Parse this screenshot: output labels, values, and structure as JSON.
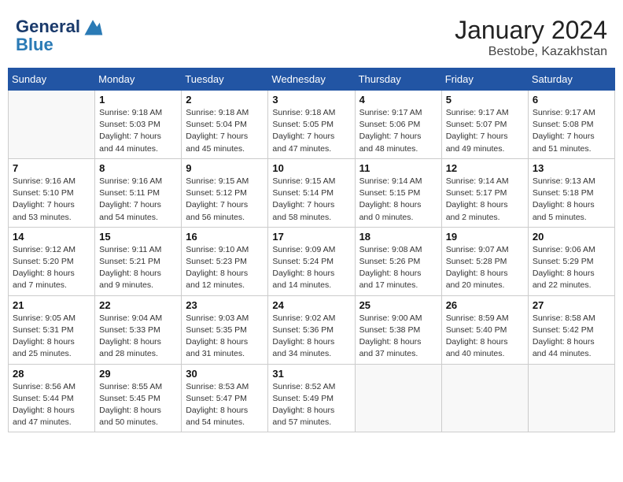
{
  "header": {
    "logo_line1": "General",
    "logo_line2": "Blue",
    "month": "January 2024",
    "location": "Bestobe, Kazakhstan"
  },
  "weekdays": [
    "Sunday",
    "Monday",
    "Tuesday",
    "Wednesday",
    "Thursday",
    "Friday",
    "Saturday"
  ],
  "weeks": [
    [
      {
        "day": "",
        "info": ""
      },
      {
        "day": "1",
        "info": "Sunrise: 9:18 AM\nSunset: 5:03 PM\nDaylight: 7 hours\nand 44 minutes."
      },
      {
        "day": "2",
        "info": "Sunrise: 9:18 AM\nSunset: 5:04 PM\nDaylight: 7 hours\nand 45 minutes."
      },
      {
        "day": "3",
        "info": "Sunrise: 9:18 AM\nSunset: 5:05 PM\nDaylight: 7 hours\nand 47 minutes."
      },
      {
        "day": "4",
        "info": "Sunrise: 9:17 AM\nSunset: 5:06 PM\nDaylight: 7 hours\nand 48 minutes."
      },
      {
        "day": "5",
        "info": "Sunrise: 9:17 AM\nSunset: 5:07 PM\nDaylight: 7 hours\nand 49 minutes."
      },
      {
        "day": "6",
        "info": "Sunrise: 9:17 AM\nSunset: 5:08 PM\nDaylight: 7 hours\nand 51 minutes."
      }
    ],
    [
      {
        "day": "7",
        "info": "Sunrise: 9:16 AM\nSunset: 5:10 PM\nDaylight: 7 hours\nand 53 minutes."
      },
      {
        "day": "8",
        "info": "Sunrise: 9:16 AM\nSunset: 5:11 PM\nDaylight: 7 hours\nand 54 minutes."
      },
      {
        "day": "9",
        "info": "Sunrise: 9:15 AM\nSunset: 5:12 PM\nDaylight: 7 hours\nand 56 minutes."
      },
      {
        "day": "10",
        "info": "Sunrise: 9:15 AM\nSunset: 5:14 PM\nDaylight: 7 hours\nand 58 minutes."
      },
      {
        "day": "11",
        "info": "Sunrise: 9:14 AM\nSunset: 5:15 PM\nDaylight: 8 hours\nand 0 minutes."
      },
      {
        "day": "12",
        "info": "Sunrise: 9:14 AM\nSunset: 5:17 PM\nDaylight: 8 hours\nand 2 minutes."
      },
      {
        "day": "13",
        "info": "Sunrise: 9:13 AM\nSunset: 5:18 PM\nDaylight: 8 hours\nand 5 minutes."
      }
    ],
    [
      {
        "day": "14",
        "info": "Sunrise: 9:12 AM\nSunset: 5:20 PM\nDaylight: 8 hours\nand 7 minutes."
      },
      {
        "day": "15",
        "info": "Sunrise: 9:11 AM\nSunset: 5:21 PM\nDaylight: 8 hours\nand 9 minutes."
      },
      {
        "day": "16",
        "info": "Sunrise: 9:10 AM\nSunset: 5:23 PM\nDaylight: 8 hours\nand 12 minutes."
      },
      {
        "day": "17",
        "info": "Sunrise: 9:09 AM\nSunset: 5:24 PM\nDaylight: 8 hours\nand 14 minutes."
      },
      {
        "day": "18",
        "info": "Sunrise: 9:08 AM\nSunset: 5:26 PM\nDaylight: 8 hours\nand 17 minutes."
      },
      {
        "day": "19",
        "info": "Sunrise: 9:07 AM\nSunset: 5:28 PM\nDaylight: 8 hours\nand 20 minutes."
      },
      {
        "day": "20",
        "info": "Sunrise: 9:06 AM\nSunset: 5:29 PM\nDaylight: 8 hours\nand 22 minutes."
      }
    ],
    [
      {
        "day": "21",
        "info": "Sunrise: 9:05 AM\nSunset: 5:31 PM\nDaylight: 8 hours\nand 25 minutes."
      },
      {
        "day": "22",
        "info": "Sunrise: 9:04 AM\nSunset: 5:33 PM\nDaylight: 8 hours\nand 28 minutes."
      },
      {
        "day": "23",
        "info": "Sunrise: 9:03 AM\nSunset: 5:35 PM\nDaylight: 8 hours\nand 31 minutes."
      },
      {
        "day": "24",
        "info": "Sunrise: 9:02 AM\nSunset: 5:36 PM\nDaylight: 8 hours\nand 34 minutes."
      },
      {
        "day": "25",
        "info": "Sunrise: 9:00 AM\nSunset: 5:38 PM\nDaylight: 8 hours\nand 37 minutes."
      },
      {
        "day": "26",
        "info": "Sunrise: 8:59 AM\nSunset: 5:40 PM\nDaylight: 8 hours\nand 40 minutes."
      },
      {
        "day": "27",
        "info": "Sunrise: 8:58 AM\nSunset: 5:42 PM\nDaylight: 8 hours\nand 44 minutes."
      }
    ],
    [
      {
        "day": "28",
        "info": "Sunrise: 8:56 AM\nSunset: 5:44 PM\nDaylight: 8 hours\nand 47 minutes."
      },
      {
        "day": "29",
        "info": "Sunrise: 8:55 AM\nSunset: 5:45 PM\nDaylight: 8 hours\nand 50 minutes."
      },
      {
        "day": "30",
        "info": "Sunrise: 8:53 AM\nSunset: 5:47 PM\nDaylight: 8 hours\nand 54 minutes."
      },
      {
        "day": "31",
        "info": "Sunrise: 8:52 AM\nSunset: 5:49 PM\nDaylight: 8 hours\nand 57 minutes."
      },
      {
        "day": "",
        "info": ""
      },
      {
        "day": "",
        "info": ""
      },
      {
        "day": "",
        "info": ""
      }
    ]
  ]
}
